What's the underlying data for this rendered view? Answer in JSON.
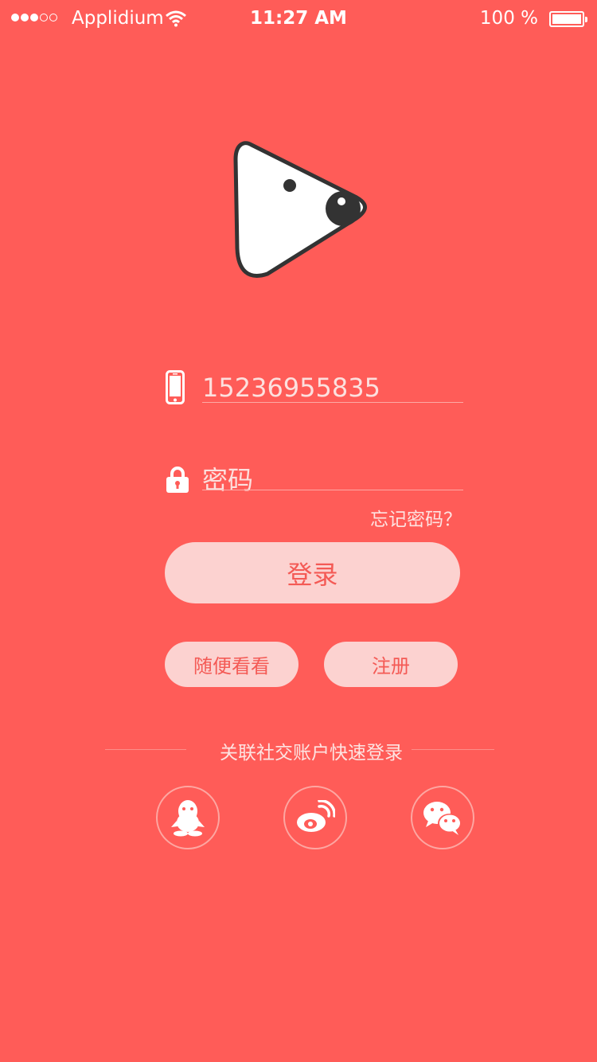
{
  "status_bar": {
    "carrier": "Applidium",
    "time": "11:27 AM",
    "battery": "100 %",
    "signal_icon": "signal-dots-icon",
    "wifi_icon": "wifi-icon",
    "battery_icon": "battery-icon"
  },
  "login": {
    "phone_value": "15236955835",
    "phone_icon": "phone-icon",
    "password_placeholder": "密码",
    "password_icon": "lock-icon",
    "forgot_label": "忘记密码？",
    "login_label": "登录",
    "browse_label": "随便看看",
    "register_label": "注册"
  },
  "social": {
    "title": "关联社交账户快速登录",
    "items": [
      {
        "name": "qq",
        "icon": "qq-icon"
      },
      {
        "name": "weibo",
        "icon": "weibo-icon"
      },
      {
        "name": "wechat",
        "icon": "wechat-icon"
      }
    ]
  },
  "colors": {
    "background": "#FF5C58",
    "button_fill": "#FCD2D0",
    "button_text": "#F45A55"
  }
}
